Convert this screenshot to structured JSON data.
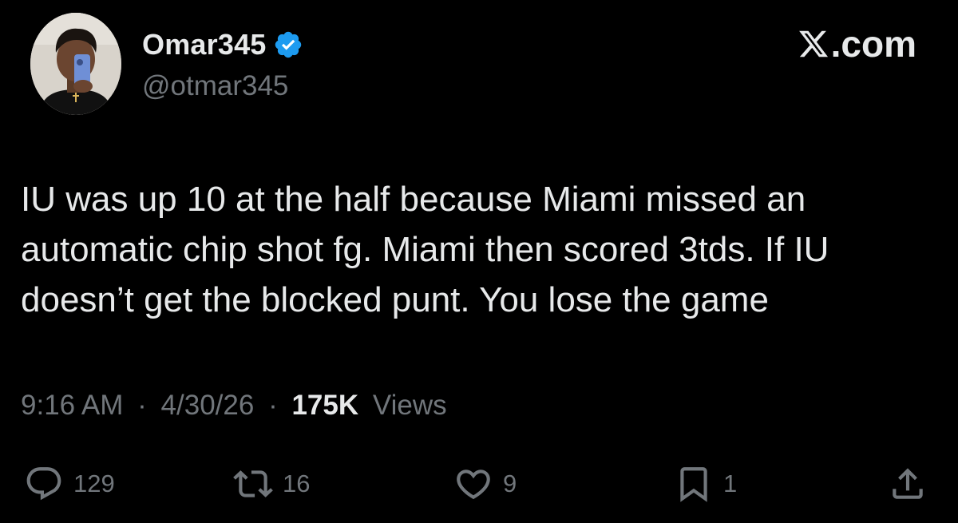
{
  "author": {
    "display_name": "Omar345",
    "handle": "@otmar345",
    "verified_color": "#1d9bf0"
  },
  "site": {
    "label": ".com",
    "logo_icon": "x-logo-icon"
  },
  "tweet": {
    "text": "IU was up 10 at the half because Miami missed an automatic chip shot fg. Miami then scored 3tds. If IU doesn’t get the blocked punt. You lose the game",
    "time": "9:16 AM",
    "separator": "·",
    "date": "4/30/26",
    "views_count": "175K",
    "views_label": "Views"
  },
  "actions": {
    "reply_count": "129",
    "repost_count": "16",
    "like_count": "9",
    "bookmark_count": "1"
  },
  "colors": {
    "background": "#000000",
    "primary_text": "#e7e9ea",
    "secondary_text": "#71767b",
    "accent": "#1d9bf0"
  }
}
